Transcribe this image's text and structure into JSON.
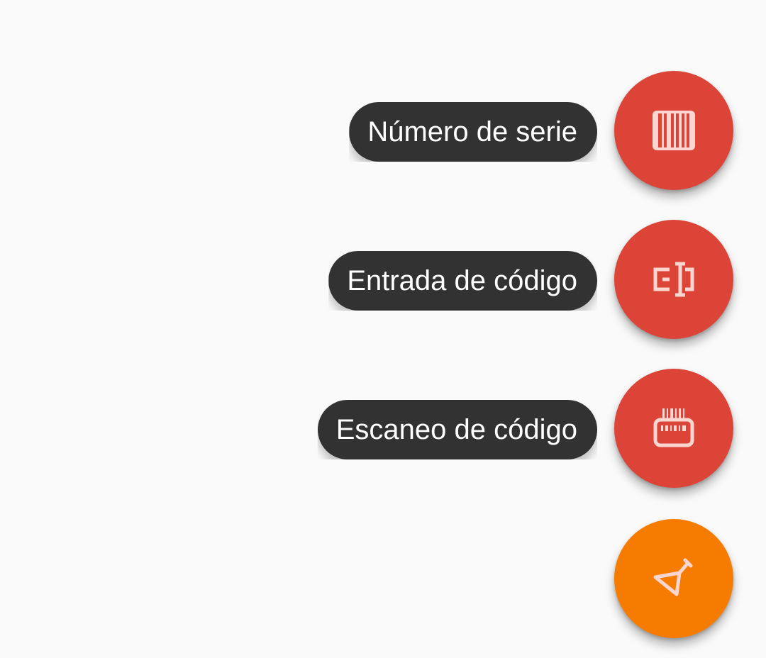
{
  "actions": [
    {
      "label": "Número de serie",
      "icon": "serial-number-icon",
      "color": "#db4437"
    },
    {
      "label": "Entrada de código",
      "icon": "text-cursor-input-icon",
      "color": "#db4437"
    },
    {
      "label": "Escaneo de código",
      "icon": "barcode-scanner-icon",
      "color": "#db4437"
    }
  ],
  "main_fab": {
    "icon": "send-icon",
    "color": "#f57c00"
  },
  "colors": {
    "background": "#fafafa",
    "label_bg": "#323232",
    "label_text": "#ffffff",
    "icon": "#fbd5cf"
  }
}
